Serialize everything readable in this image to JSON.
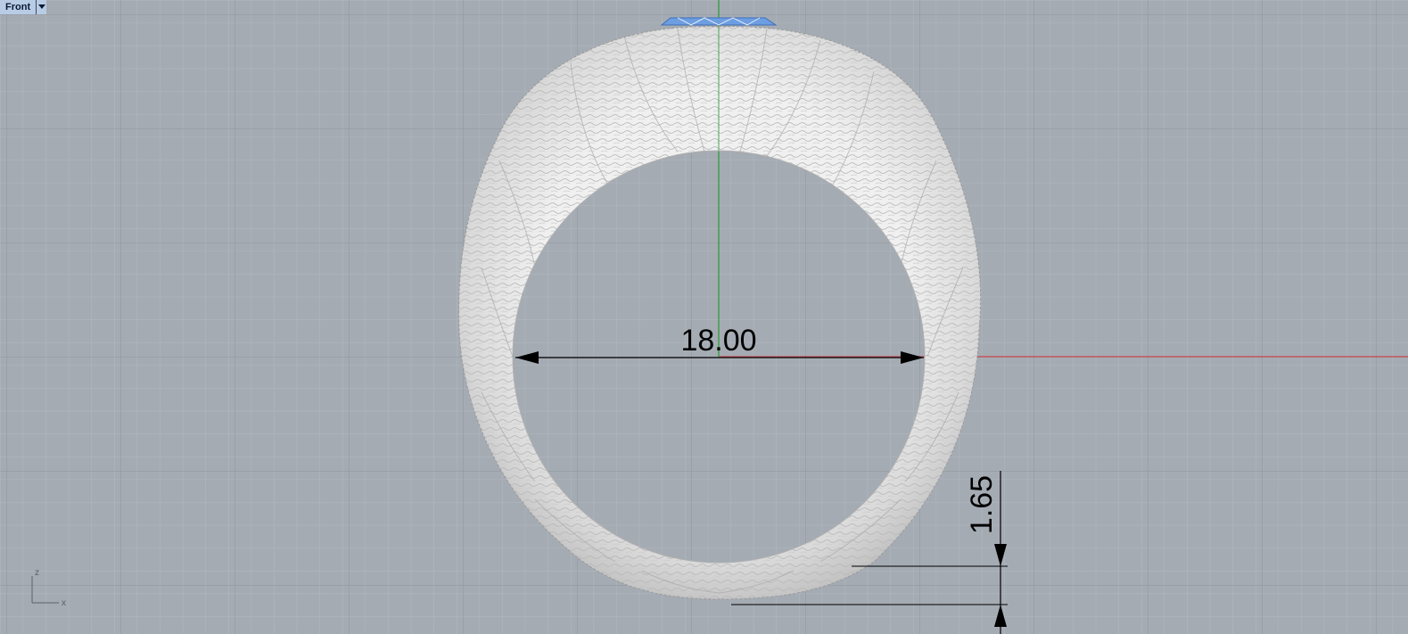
{
  "viewport": {
    "title": "Front",
    "menu_icon": "chevron-down-icon",
    "background": "#a5abb3",
    "grid_minor": "#b2b8bf",
    "grid_major": "#8e959d",
    "axis_x_color": "#c0565a",
    "axis_y_color": "#3e9e4c"
  },
  "ring": {
    "fill": "#e6e6e6",
    "shade": "#cfcfcf",
    "prong_color": "#6d9ee2"
  },
  "dimensions": {
    "inner_diameter": "18.00",
    "thickness": "1.65"
  },
  "axis_widget": {
    "up_label": "z",
    "right_label": "x"
  }
}
